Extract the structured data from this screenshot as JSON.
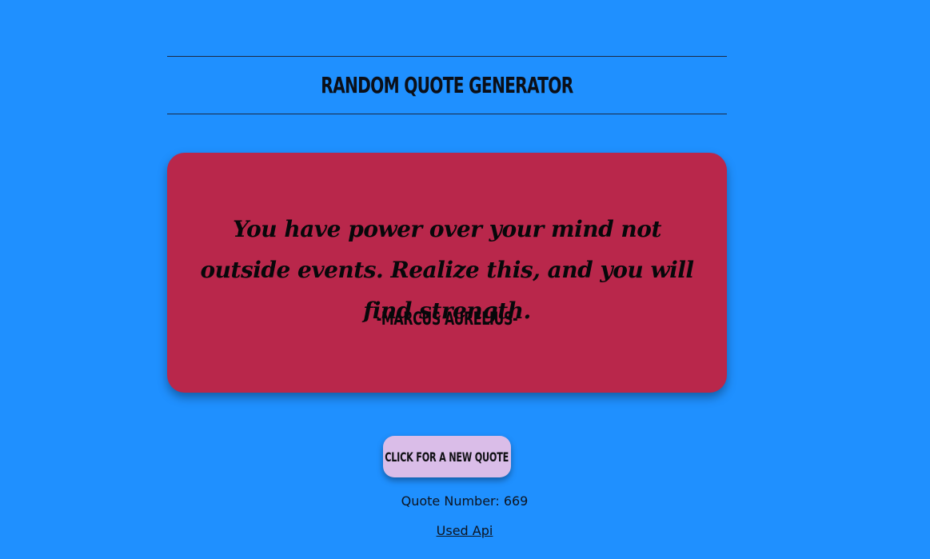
{
  "header": {
    "title": "Random Quote Generator"
  },
  "quote": {
    "text": "You have power over your mind not outside events. Realize this, and you will find strength.",
    "author": "-Marcus Aurelius-"
  },
  "actions": {
    "new_quote_label": "Click for a new quote"
  },
  "footer": {
    "quote_number": "Quote Number: 669",
    "api_link_label": "Used Api"
  },
  "colors": {
    "background": "#1f90ff",
    "card": "#b9274b",
    "button": "#dabde8"
  }
}
